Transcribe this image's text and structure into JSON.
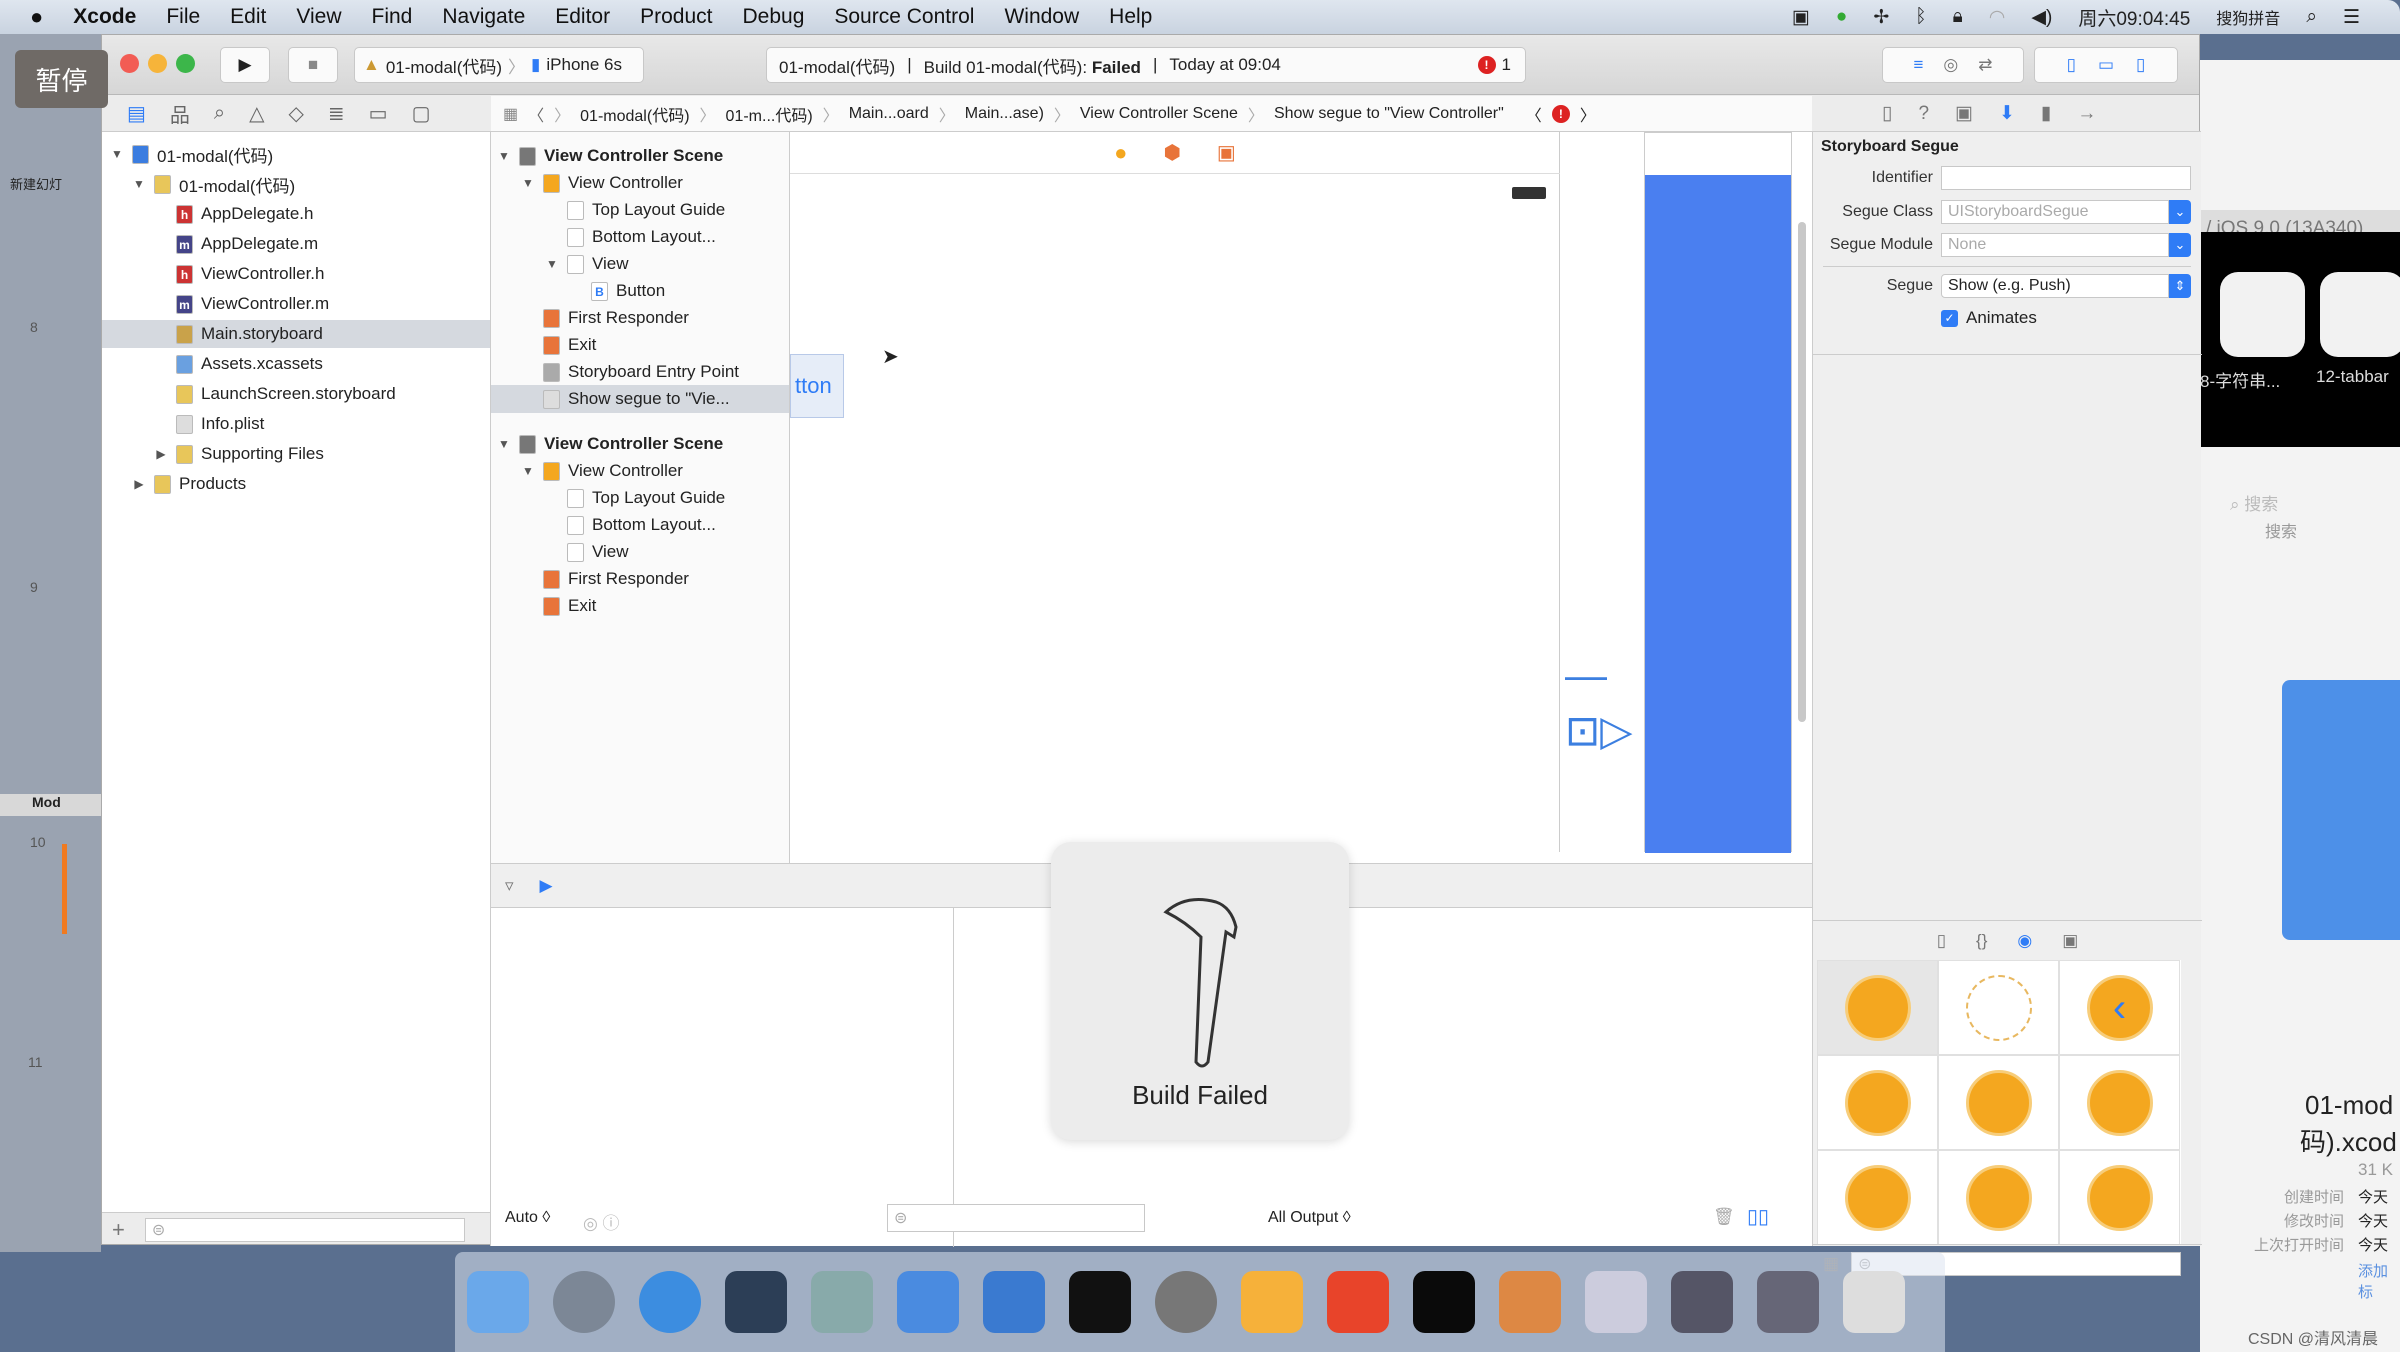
{
  "menubar": {
    "items": [
      "Xcode",
      "File",
      "Edit",
      "View",
      "Find",
      "Navigate",
      "Editor",
      "Product",
      "Debug",
      "Source Control",
      "Window",
      "Help"
    ],
    "clock": "周六09:04:45",
    "input_method": "搜狗拼音"
  },
  "overlay": {
    "pause": "暂停"
  },
  "left_app": {
    "new_slide": "新建幻灯",
    "slides": [
      "8",
      "9",
      "10",
      "11"
    ],
    "section": "Mod"
  },
  "toolbar": {
    "scheme": "01-modal(代码)",
    "device": "iPhone 6s",
    "activity_project": "01-modal(代码)",
    "activity_status_prefix": "Build 01-modal(代码):",
    "activity_status": "Failed",
    "activity_time": "Today at 09:04",
    "error_count": "1"
  },
  "jumpbar": {
    "items": [
      "01-modal(代码)",
      "01-m...代码)",
      "Main...oard",
      "Main...ase)",
      "View Controller Scene",
      "Show segue to \"View Controller\""
    ]
  },
  "navigator": {
    "items": [
      {
        "label": "01-modal(代码)",
        "level": 0,
        "arrow": "▼",
        "icon": "project",
        "color": "#3b7de0"
      },
      {
        "label": "01-modal(代码)",
        "level": 1,
        "arrow": "▼",
        "icon": "folder",
        "color": "#e8c65a"
      },
      {
        "label": "AppDelegate.h",
        "level": 2,
        "icon": "h",
        "color": "#c33"
      },
      {
        "label": "AppDelegate.m",
        "level": 2,
        "icon": "m",
        "color": "#448"
      },
      {
        "label": "ViewController.h",
        "level": 2,
        "icon": "h",
        "color": "#c33"
      },
      {
        "label": "ViewController.m",
        "level": 2,
        "icon": "m",
        "color": "#448"
      },
      {
        "label": "Main.storyboard",
        "level": 2,
        "icon": "storyboard",
        "color": "#c9a24a",
        "selected": true
      },
      {
        "label": "Assets.xcassets",
        "level": 2,
        "icon": "folder",
        "color": "#6aa0e0"
      },
      {
        "label": "LaunchScreen.storyboard",
        "level": 2,
        "icon": "storyboard",
        "color": "#e8c65a"
      },
      {
        "label": "Info.plist",
        "level": 2,
        "icon": "plist",
        "color": "#ddd"
      },
      {
        "label": "Supporting Files",
        "level": 2,
        "arrow": "▶",
        "icon": "folder",
        "color": "#e8c65a",
        "indent_left": true
      },
      {
        "label": "Products",
        "level": 1,
        "arrow": "▶",
        "icon": "folder",
        "color": "#e8c65a"
      }
    ]
  },
  "outline": {
    "items": [
      {
        "label": "View Controller Scene",
        "level": 0,
        "arrow": "▼",
        "bold": true,
        "icon": "scene",
        "color": "#777"
      },
      {
        "label": "View Controller",
        "level": 1,
        "arrow": "▼",
        "icon": "vc",
        "color": "#f4a71f"
      },
      {
        "label": "Top Layout Guide",
        "level": 2,
        "icon": "guide",
        "color": "#fff"
      },
      {
        "label": "Bottom Layout...",
        "level": 2,
        "icon": "guide",
        "color": "#fff"
      },
      {
        "label": "View",
        "level": 2,
        "arrow": "▼",
        "icon": "view",
        "color": "#fff"
      },
      {
        "label": "Button",
        "level": 3,
        "icon": "B",
        "color": "#fff"
      },
      {
        "label": "First Responder",
        "level": 1,
        "icon": "responder",
        "color": "#e8743a"
      },
      {
        "label": "Exit",
        "level": 1,
        "icon": "exit",
        "color": "#e8743a"
      },
      {
        "label": "Storyboard Entry Point",
        "level": 1,
        "icon": "arrow",
        "color": "#aaa"
      },
      {
        "label": "Show segue to \"Vie...",
        "level": 1,
        "icon": "segue",
        "color": "#ddd",
        "selected": true
      },
      {
        "label": "View Controller Scene",
        "level": 0,
        "arrow": "▼",
        "bold": true,
        "icon": "scene",
        "color": "#777"
      },
      {
        "label": "View Controller",
        "level": 1,
        "arrow": "▼",
        "icon": "vc",
        "color": "#f4a71f"
      },
      {
        "label": "Top Layout Guide",
        "level": 2,
        "icon": "guide",
        "color": "#fff"
      },
      {
        "label": "Bottom Layout...",
        "level": 2,
        "icon": "guide",
        "color": "#fff"
      },
      {
        "label": "View",
        "level": 2,
        "icon": "view",
        "color": "#fff"
      },
      {
        "label": "First Responder",
        "level": 1,
        "icon": "responder",
        "color": "#e8743a"
      },
      {
        "label": "Exit",
        "level": 1,
        "icon": "exit",
        "color": "#e8743a"
      }
    ]
  },
  "canvas": {
    "button_label": "tton"
  },
  "inspector": {
    "title": "Storyboard Segue",
    "identifier_label": "Identifier",
    "identifier_value": "",
    "segue_class_label": "Segue Class",
    "segue_class_placeholder": "UIStoryboardSegue",
    "segue_module_label": "Segue Module",
    "segue_module_placeholder": "None",
    "segue_label": "Segue",
    "segue_value": "Show (e.g. Push)",
    "animates_label": "Animates",
    "animates_checked": true
  },
  "debug": {
    "auto_label": "Auto ◊",
    "output_label": "All Output ◊"
  },
  "hud": {
    "message": "Build Failed"
  },
  "right_window": {
    "os_version": "/ iOS 9.0 (13A340)",
    "icons": [
      "8-字符串...",
      "12-tabbar"
    ],
    "search_placeholder": "搜索",
    "search_label": "搜索",
    "file_name_1": "01-mod",
    "file_name_2": "码).xcod",
    "size": "31 K",
    "meta_labels": [
      "创建时间",
      "修改时间",
      "上次打开时间"
    ],
    "meta_values": [
      "今天",
      "今天",
      "今天"
    ],
    "add_tag": "添加标"
  },
  "watermark": "CSDN @清风清晨",
  "colors": {
    "accent": "#2f7cf6",
    "error": "#d22222",
    "canvas_view": "#4a7ff0"
  }
}
